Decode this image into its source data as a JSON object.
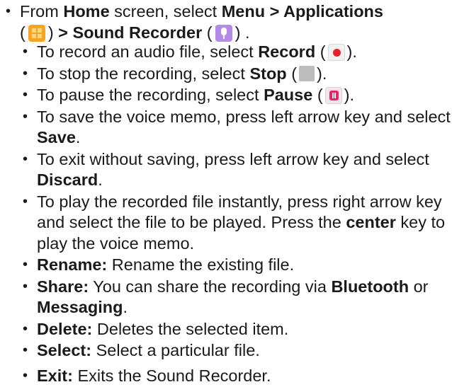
{
  "main": {
    "bullet": "•",
    "from": "From ",
    "home": "Home",
    "screen_select": " screen, select ",
    "menu_apps": "Menu > Applications",
    "open_paren": "(",
    "close_paren": ")",
    "arrow_sr": " > Sound Recorder",
    "end": " ."
  },
  "icons": {
    "apps": "apps-icon",
    "mic": "microphone-icon",
    "record": "record-icon",
    "stop": "stop-icon",
    "pause": "pause-icon"
  },
  "items": {
    "record": {
      "pre": "To record an audio file, select ",
      "bold": "Record",
      "open": " (",
      "close": ")."
    },
    "stop": {
      "pre": "To stop the recording, select ",
      "bold": "Stop",
      "open": " (",
      "close": ")."
    },
    "pause": {
      "pre": "To pause the recording, select ",
      "bold": "Pause",
      "open": " (",
      "close": ")."
    },
    "save": {
      "pre": "To save the voice memo, press left arrow key and select ",
      "bold": "Save",
      "post": "."
    },
    "discard": {
      "pre": "To exit without saving, press left arrow key and select ",
      "bold": "Discard",
      "post": "."
    },
    "play": {
      "pre": "To play the recorded file instantly, press right arrow key and select the file to be played. Press the ",
      "bold": "center",
      "post": " key to play the voice memo."
    },
    "rename": {
      "bold": "Rename:",
      "post": " Rename the existing file."
    },
    "share": {
      "bold": "Share:",
      "pre": " You can share the recording via ",
      "bt": "Bluetooth",
      "or": " or ",
      "msg": "Messaging",
      "post": "."
    },
    "delete": {
      "bold": "Delete:",
      "post": " Deletes the selected item."
    },
    "select": {
      "bold": "Select:",
      "post": " Select a particular file."
    },
    "exit": {
      "bold": "Exit:",
      "post": " Exits the Sound Recorder."
    }
  }
}
